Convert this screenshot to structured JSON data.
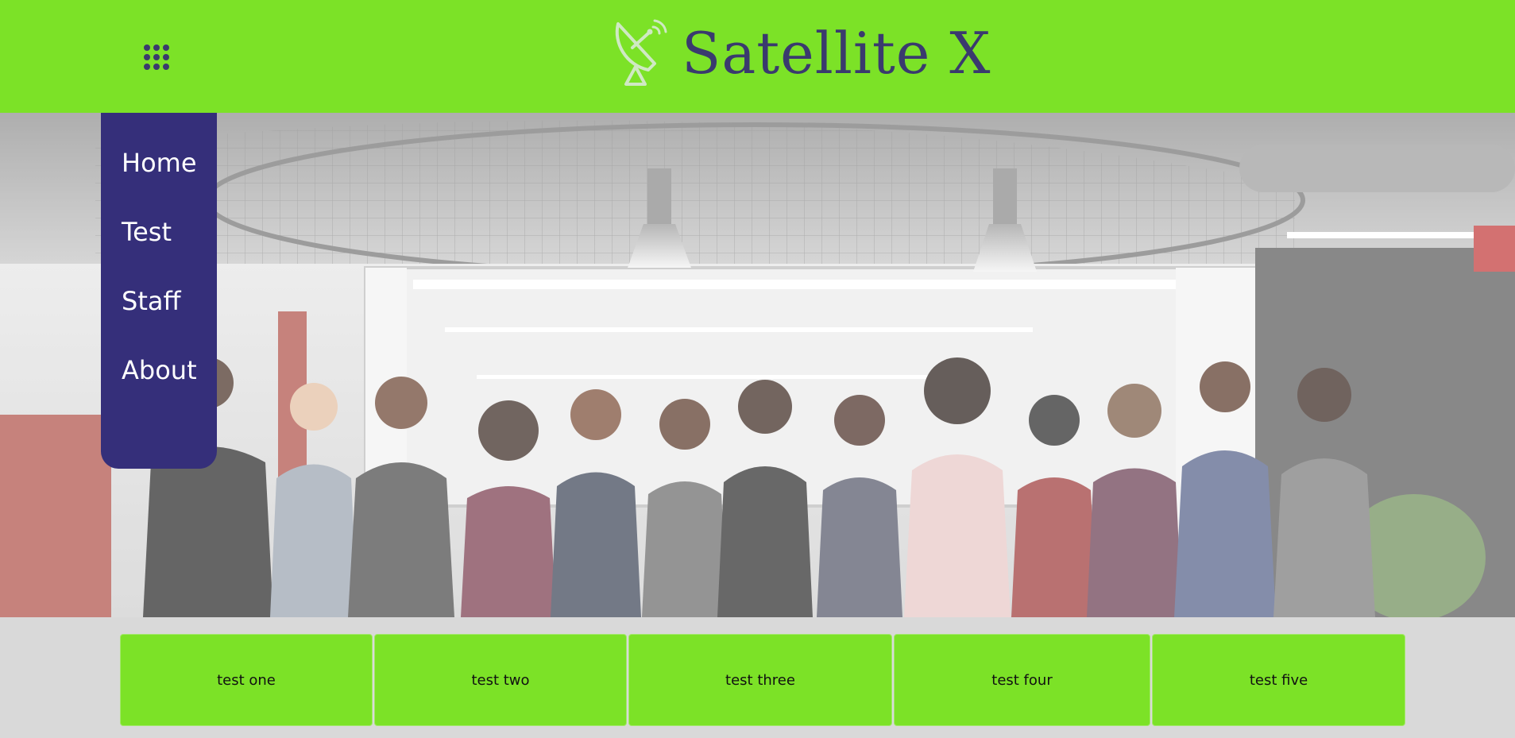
{
  "header": {
    "brand_name": "Satellite X",
    "menu_icon": "grid-menu-icon",
    "logo_icon": "satellite-dish-icon",
    "background_color": "#7ce227",
    "text_color": "#3a3a6e"
  },
  "side_nav": {
    "background_color": "#352f7a",
    "items": [
      {
        "label": "Home"
      },
      {
        "label": "Test"
      },
      {
        "label": "Staff"
      },
      {
        "label": "About"
      }
    ]
  },
  "hero": {
    "image_icon": "team-office-photo"
  },
  "cards": [
    {
      "label": "test one"
    },
    {
      "label": "test two"
    },
    {
      "label": "test three"
    },
    {
      "label": "test four"
    },
    {
      "label": "test five"
    }
  ]
}
